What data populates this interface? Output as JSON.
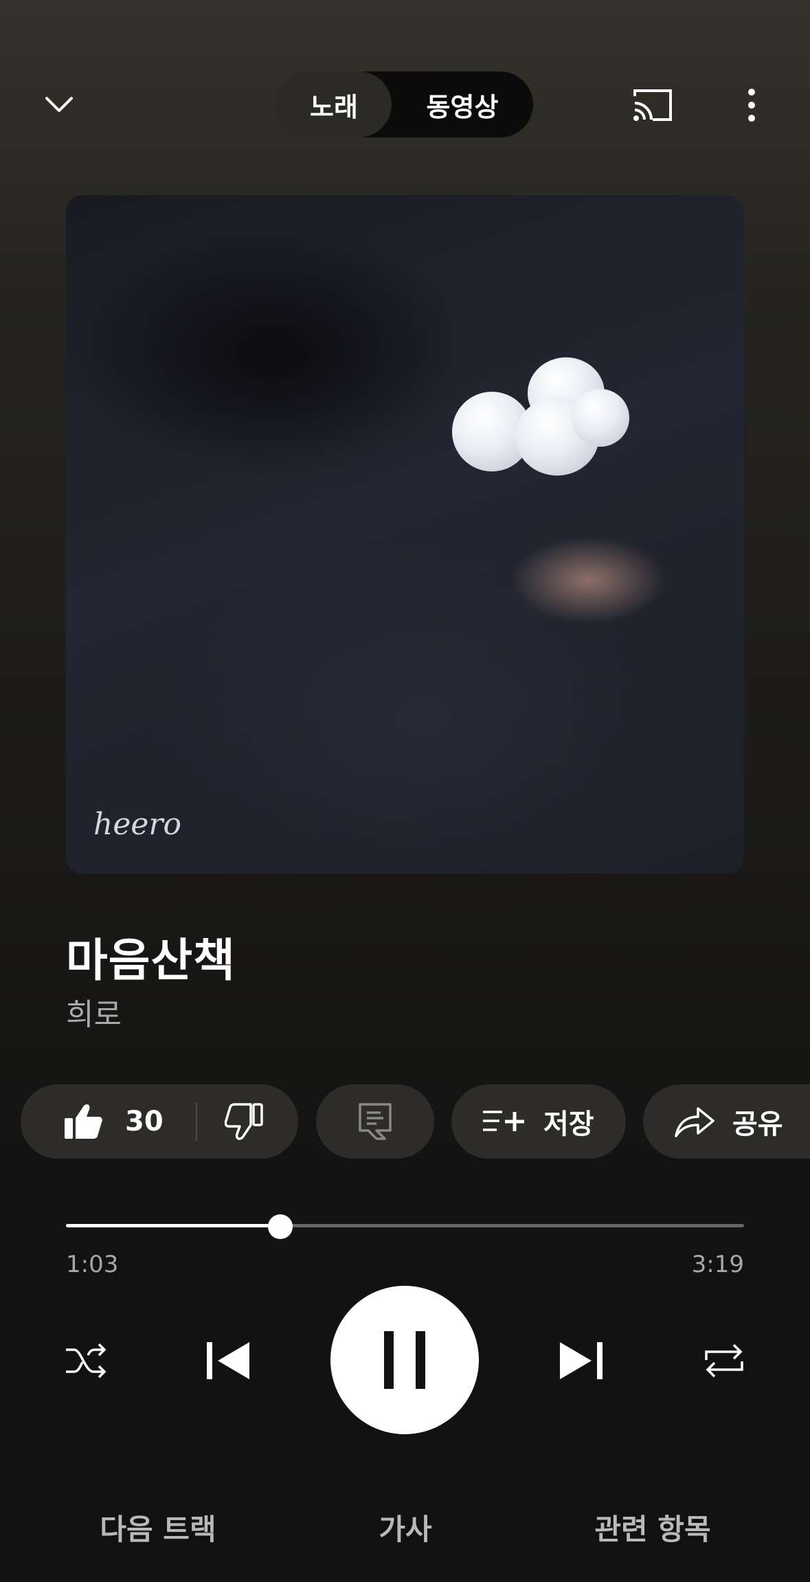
{
  "header": {
    "toggle": {
      "song_label": "노래",
      "video_label": "동영상",
      "selected": "노래"
    }
  },
  "album_art": {
    "signature": "heero"
  },
  "track": {
    "title": "마음산책",
    "artist": "희로"
  },
  "actions": {
    "like_count": "30",
    "save_label": "저장",
    "share_label": "공유"
  },
  "progress": {
    "current": "1:03",
    "total": "3:19",
    "fraction": 0.316
  },
  "controls": {
    "state": "playing"
  },
  "tabs": {
    "up_next": "다음 트랙",
    "lyrics": "가사",
    "related": "관련 항목"
  },
  "colors": {
    "accent": "#ffffff",
    "pill_bg": "#2d2c29",
    "muted_text": "#aaaaaa"
  }
}
